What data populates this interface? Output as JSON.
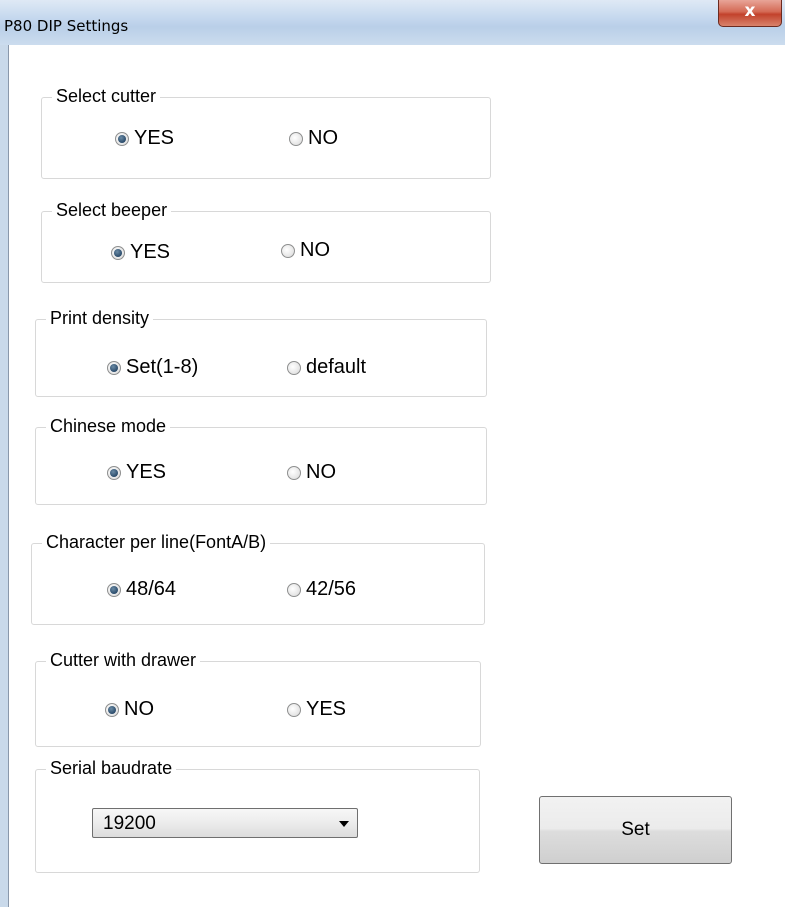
{
  "window": {
    "title": "P80 DIP Settings",
    "close_glyph": "x"
  },
  "groups": [
    {
      "label": "Select cutter",
      "options": [
        {
          "label": "YES",
          "checked": true
        },
        {
          "label": "NO",
          "checked": false
        }
      ]
    },
    {
      "label": "Select beeper",
      "options": [
        {
          "label": "YES",
          "checked": true
        },
        {
          "label": "NO",
          "checked": false
        }
      ]
    },
    {
      "label": "Print density",
      "options": [
        {
          "label": "Set(1-8)",
          "checked": true
        },
        {
          "label": "default",
          "checked": false
        }
      ]
    },
    {
      "label": "Chinese mode",
      "options": [
        {
          "label": "YES",
          "checked": true
        },
        {
          "label": "NO",
          "checked": false
        }
      ]
    },
    {
      "label": "Character per line(FontA/B)",
      "options": [
        {
          "label": "48/64",
          "checked": true
        },
        {
          "label": "42/56",
          "checked": false
        }
      ]
    },
    {
      "label": "Cutter with drawer",
      "options": [
        {
          "label": "NO",
          "checked": true
        },
        {
          "label": "YES",
          "checked": false
        }
      ]
    }
  ],
  "baudrate": {
    "label": "Serial baudrate",
    "value": "19200"
  },
  "set_button": {
    "label": "Set"
  }
}
